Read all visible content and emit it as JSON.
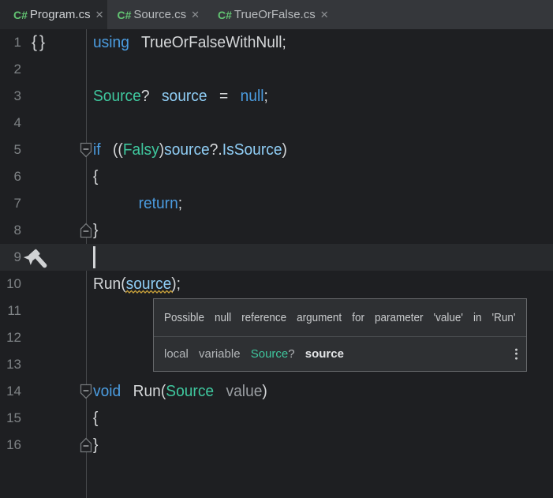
{
  "colors": {
    "editor_bg": "#1e1f22",
    "tabbar_bg": "#35373b",
    "active_tab_bg": "#26282b",
    "current_line_bg": "#282a2d",
    "tooltip_bg": "#2e3033",
    "tooltip_border": "#67696c",
    "tooltip_divider": "#4a4d50",
    "outline_line": "#47494c",
    "fold_stroke": "#76797c",
    "line_number": "#7f8386",
    "tab_label": "#ced1d4",
    "tab_label_inactive": "#b8bbbe",
    "close_icon": "#8b8e91",
    "csharp_icon_green": "#63c573",
    "keyword_blue": "#4b9ce0",
    "type_teal": "#3fc79e",
    "variable_blue": "#8fcdf5",
    "parameter_gray": "#9a9ea2",
    "plain_text": "#d5d7d9",
    "squiggle_gold": "#c9a13b",
    "cursor_color": "#d2d4d6",
    "gutter_icon_gray": "#d0d2d4",
    "tooltip_text": "#c9cbcd",
    "tooltip_text2": "#b4b7ba",
    "tooltip_bold": "#e4e6e8"
  },
  "tabs": [
    {
      "icon": "C#",
      "label": "Program.cs",
      "close": "✕",
      "active": true
    },
    {
      "icon": "C#",
      "label": "Source.cs",
      "close": "✕",
      "active": false
    },
    {
      "icon": "C#",
      "label": "TrueOrFalse.cs",
      "close": "✕",
      "active": false
    }
  ],
  "editor": {
    "lines": [
      {
        "num": "1",
        "gutter": "braces",
        "tokens": [
          [
            "kw",
            "using "
          ],
          [
            "pl",
            "TrueOrFalseWithNull;"
          ]
        ]
      },
      {
        "num": "2",
        "tokens": []
      },
      {
        "num": "3",
        "tokens": [
          [
            "ty",
            "Source"
          ],
          [
            "pl",
            "? "
          ],
          [
            "va",
            "source"
          ],
          [
            "pl",
            " = "
          ],
          [
            "kw",
            "null"
          ],
          [
            "pl",
            ";"
          ]
        ]
      },
      {
        "num": "4",
        "tokens": []
      },
      {
        "num": "5",
        "fold": "start",
        "tokens": [
          [
            "kw",
            "if "
          ],
          [
            "pl",
            "(("
          ],
          [
            "ty",
            "Falsy"
          ],
          [
            "pl",
            ")"
          ],
          [
            "va",
            "source"
          ],
          [
            "pl",
            "?."
          ],
          [
            "va",
            "IsSource"
          ],
          [
            "pl",
            ")"
          ]
        ]
      },
      {
        "num": "6",
        "tokens": [
          [
            "pl",
            "{"
          ]
        ]
      },
      {
        "num": "7",
        "indent": 1,
        "tokens": [
          [
            "kw",
            "return"
          ],
          [
            "pl",
            ";"
          ]
        ]
      },
      {
        "num": "8",
        "fold": "end",
        "tokens": [
          [
            "pl",
            "}"
          ]
        ]
      },
      {
        "num": "9",
        "gutter": "hammer",
        "current": true,
        "cursor": true,
        "tokens": []
      },
      {
        "num": "10",
        "tokens": [
          [
            "pl",
            "Run("
          ],
          [
            "va sq",
            "source"
          ],
          [
            "pl",
            ");"
          ]
        ]
      },
      {
        "num": "11",
        "tokens": []
      },
      {
        "num": "12",
        "tokens": []
      },
      {
        "num": "13",
        "tokens": []
      },
      {
        "num": "14",
        "fold": "start",
        "tokens": [
          [
            "kw",
            "void "
          ],
          [
            "pl",
            "Run("
          ],
          [
            "ty",
            "Source"
          ],
          [
            "pl",
            " "
          ],
          [
            "pa",
            "value"
          ],
          [
            "pl",
            ")"
          ]
        ]
      },
      {
        "num": "15",
        "tokens": [
          [
            "pl",
            "{"
          ]
        ]
      },
      {
        "num": "16",
        "fold": "end",
        "tokens": [
          [
            "pl",
            "}"
          ]
        ]
      }
    ]
  },
  "tooltip": {
    "row1": "Possible null reference argument for parameter 'value' in 'Run'",
    "row2": [
      [
        "t2",
        "local variable "
      ],
      [
        "ty",
        "Source"
      ],
      [
        "t2",
        "? "
      ],
      [
        "t2b",
        "source"
      ]
    ]
  }
}
